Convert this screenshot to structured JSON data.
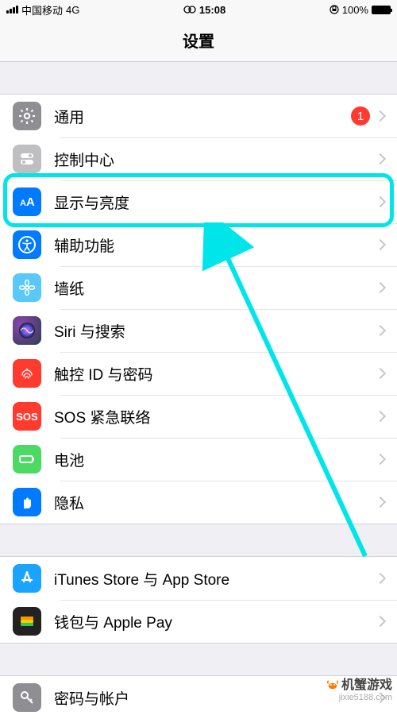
{
  "status_bar": {
    "carrier": "中国移动",
    "network": "4G",
    "time": "15:08",
    "battery_pct": "100%"
  },
  "nav": {
    "title": "设置"
  },
  "groups": [
    {
      "items": [
        {
          "key": "general",
          "label": "通用",
          "badge": "1"
        },
        {
          "key": "control-center",
          "label": "控制中心"
        },
        {
          "key": "display",
          "label": "显示与亮度"
        },
        {
          "key": "accessibility",
          "label": "辅助功能"
        },
        {
          "key": "wallpaper",
          "label": "墙纸"
        },
        {
          "key": "siri",
          "label": "Siri 与搜索"
        },
        {
          "key": "touchid",
          "label": "触控 ID 与密码"
        },
        {
          "key": "sos",
          "label": "SOS 紧急联络"
        },
        {
          "key": "battery",
          "label": "电池"
        },
        {
          "key": "privacy",
          "label": "隐私"
        }
      ]
    },
    {
      "items": [
        {
          "key": "itunes",
          "label": "iTunes Store 与 App Store"
        },
        {
          "key": "wallet",
          "label": "钱包与 Apple Pay"
        }
      ]
    },
    {
      "items": [
        {
          "key": "passwords",
          "label": "密码与帐户"
        }
      ]
    }
  ],
  "watermark": {
    "brand": "机蟹游戏",
    "url": "jixie5188.com"
  }
}
